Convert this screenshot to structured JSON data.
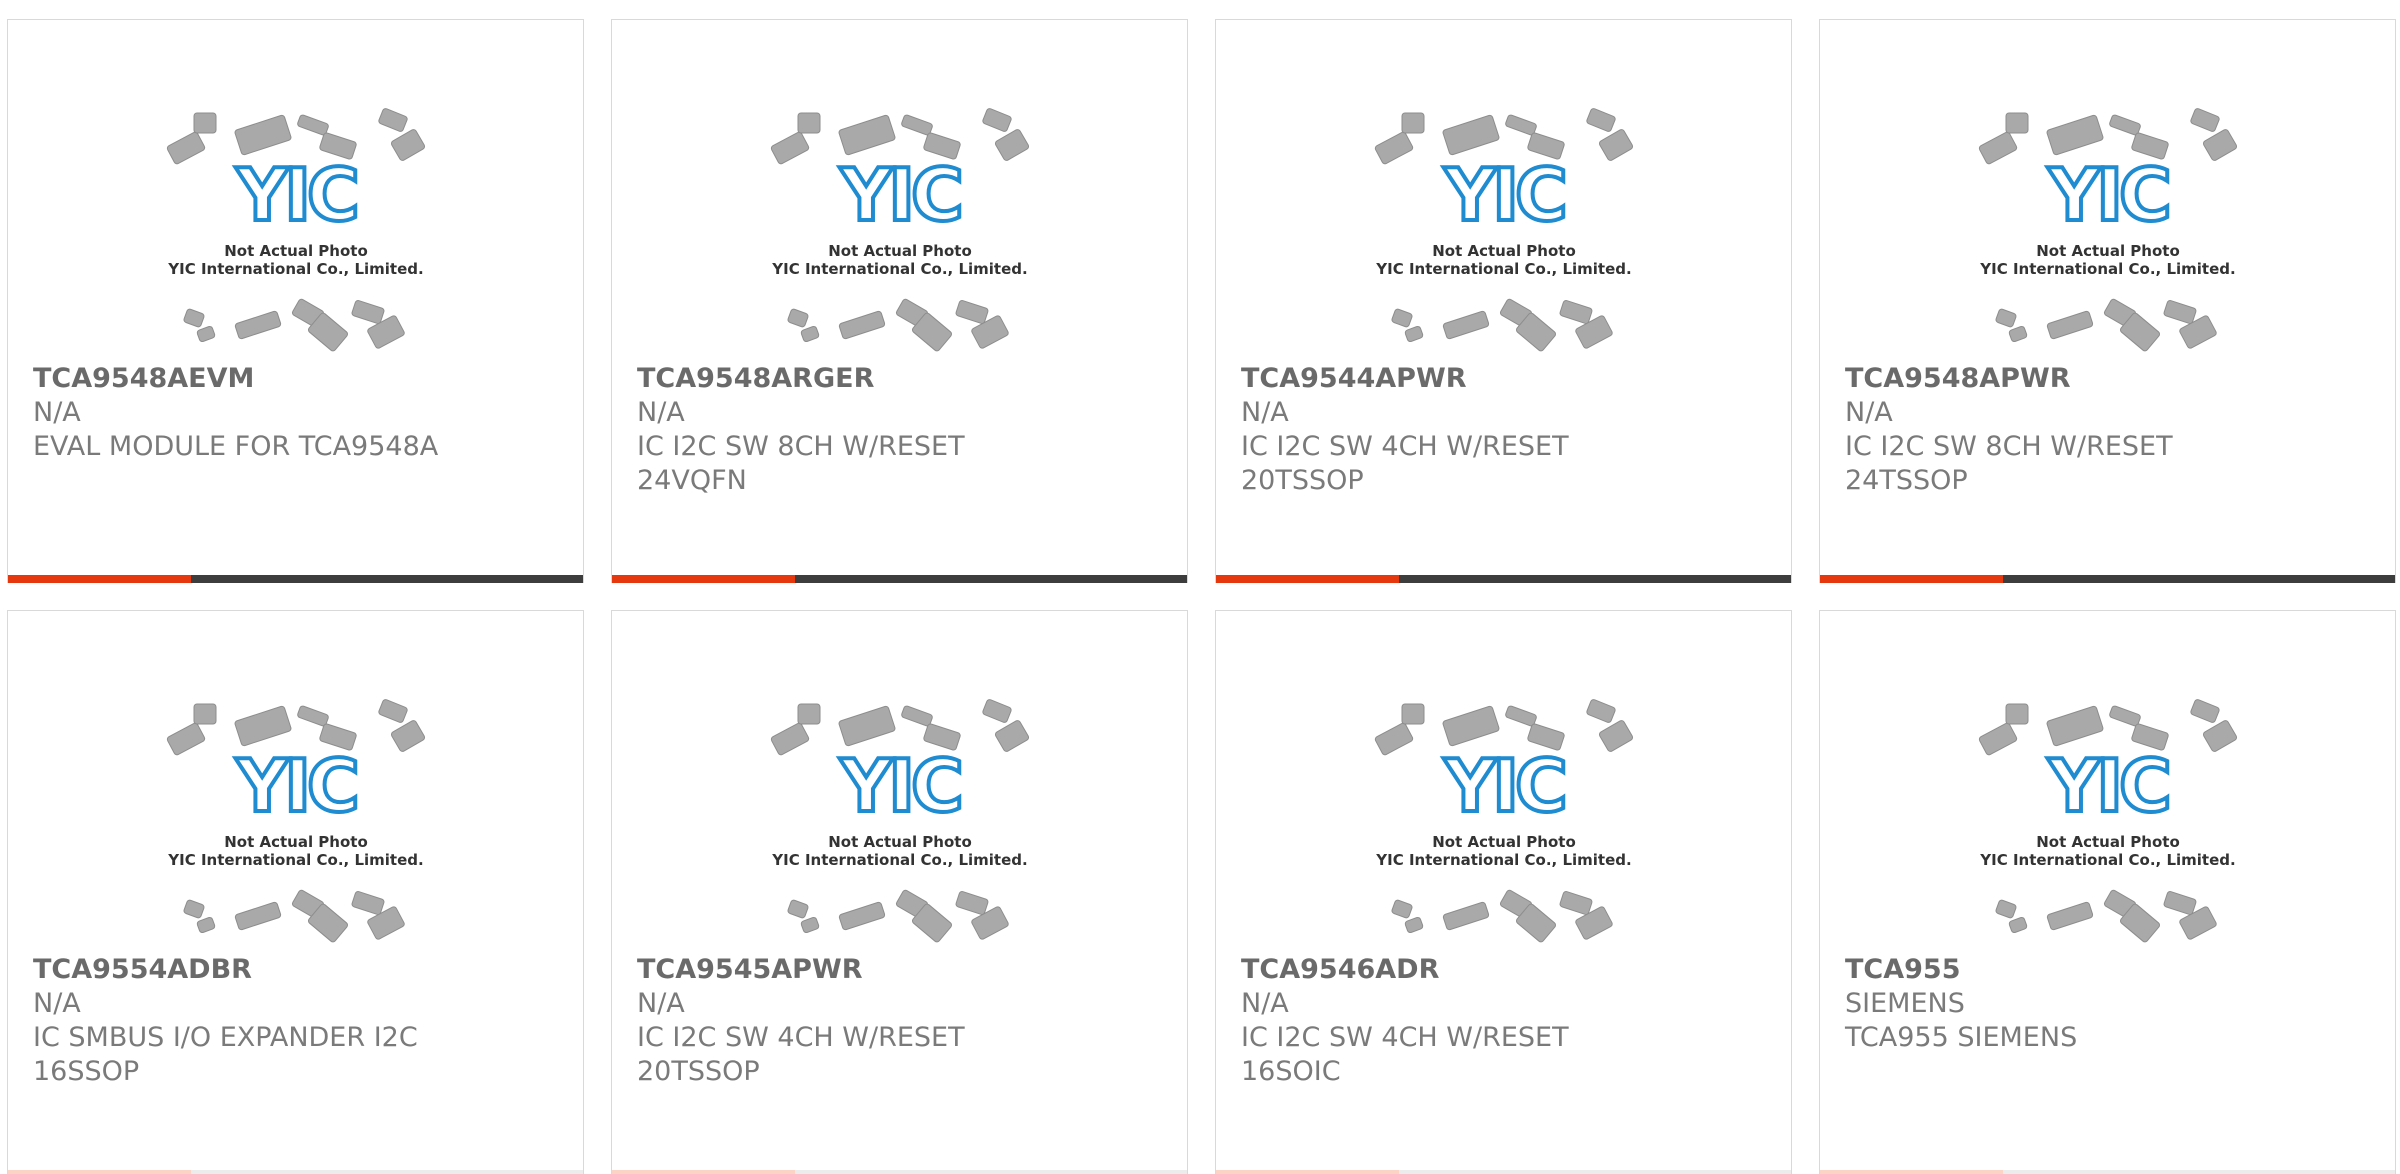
{
  "placeholder": {
    "line1": "Not Actual Photo",
    "line2": "YIC International Co., Limited.",
    "logo_text": "YIC"
  },
  "colors": {
    "accent": "#e5380f",
    "bar_dark": "#3d3d3d",
    "logo_blue": "#1f8bd0",
    "chip_gray": "#a9a9a9"
  },
  "products": [
    {
      "part": "TCA9548AEVM",
      "mfr": "N/A",
      "desc": "EVAL MODULE FOR TCA9548A"
    },
    {
      "part": "TCA9548ARGER",
      "mfr": "N/A",
      "desc": "IC I2C SW 8CH W/RESET 24VQFN"
    },
    {
      "part": "TCA9544APWR",
      "mfr": "N/A",
      "desc": "IC I2C SW 4CH W/RESET 20TSSOP"
    },
    {
      "part": "TCA9548APWR",
      "mfr": "N/A",
      "desc": "IC I2C SW 8CH W/RESET 24TSSOP"
    },
    {
      "part": "TCA9554ADBR",
      "mfr": "N/A",
      "desc": "IC SMBUS I/O EXPANDER I2C 16SSOP"
    },
    {
      "part": "TCA9545APWR",
      "mfr": "N/A",
      "desc": "IC I2C SW 4CH W/RESET 20TSSOP"
    },
    {
      "part": "TCA9546ADR",
      "mfr": "N/A",
      "desc": "IC I2C SW 4CH W/RESET 16SOIC"
    },
    {
      "part": "TCA955",
      "mfr": "SIEMENS",
      "desc": "TCA955 SIEMENS"
    }
  ]
}
